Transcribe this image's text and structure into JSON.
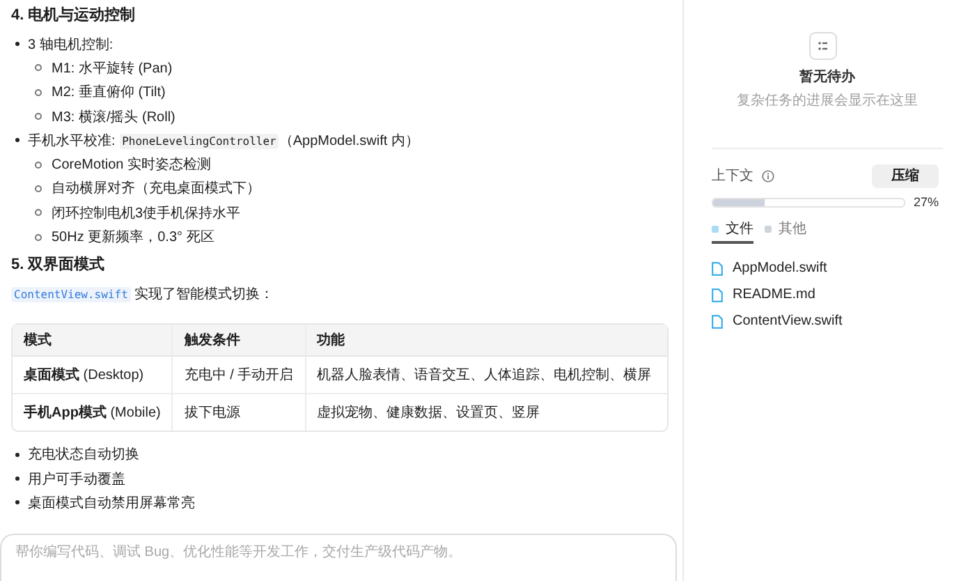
{
  "document": [
    {
      "kind": "heading",
      "text": "4. 电机与运动控制"
    },
    {
      "kind": "bullet",
      "text": "3 轴电机控制:",
      "children": [
        {
          "text": "M1: 水平旋转 (Pan)"
        },
        {
          "text": "M2: 垂直俯仰 (Tilt)"
        },
        {
          "text": "M3: 横滚/摇头 (Roll)"
        }
      ]
    },
    {
      "kind": "bullet",
      "text": "手机水平校准: ",
      "code": "PhoneLevelingController",
      "after": "（AppModel.swift 内）",
      "children": [
        {
          "text": "CoreMotion 实时姿态检测"
        },
        {
          "text": "自动横屏对齐（充电桌面模式下）"
        },
        {
          "text": "闭环控制电机3使手机保持水平"
        },
        {
          "text": "50Hz 更新频率，0.3° 死区"
        }
      ]
    },
    {
      "kind": "heading",
      "text": "5. 双界面模式"
    },
    {
      "kind": "paragraph",
      "code": "ContentView.swift",
      "text": " 实现了智能模式切换："
    },
    {
      "kind": "table",
      "columns": [
        "模式",
        "触发条件",
        "功能"
      ],
      "rows": [
        [
          "**桌面模式** (Desktop)",
          "充电中 / 手动开启",
          "机器人脸表情、语音交互、人体追踪、电机控制、横屏"
        ],
        [
          "**手机App模式** (Mobile)",
          "拔下电源",
          "虚拟宠物、健康数据、设置页、竖屏"
        ]
      ]
    },
    {
      "kind": "bullet",
      "text": "充电状态自动切换"
    },
    {
      "kind": "bullet",
      "text": "用户可手动覆盖"
    },
    {
      "kind": "bullet",
      "text": "桌面模式自动禁用屏幕常亮"
    }
  ],
  "composer": {
    "placeholder": "帮你编写代码、调试 Bug、优化性能等开发工作，交付生产级代码产物。"
  },
  "todo": {
    "title": "暂无待办",
    "subtitle": "复杂任务的进展会显示在这里"
  },
  "context": {
    "label": "上下文",
    "button": "压缩",
    "level": 0.27,
    "reading": "27%",
    "tabs": [
      {
        "label": "文件",
        "selected": true,
        "color": "#a9dcf5"
      },
      {
        "label": "其他",
        "selected": false,
        "color": "#cfd3da"
      }
    ],
    "files": [
      "AppModel.swift",
      "README.md",
      "ContentView.swift"
    ]
  }
}
